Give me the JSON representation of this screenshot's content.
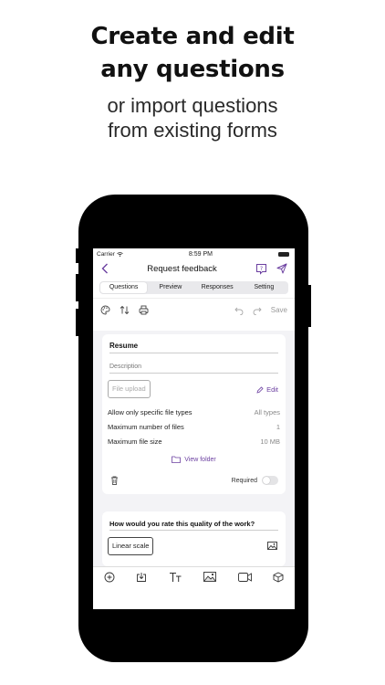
{
  "marketing": {
    "headline_line1": "Create and edit",
    "headline_line2": "any questions",
    "sub_line1": "or import questions",
    "sub_line2": "from existing forms"
  },
  "status_bar": {
    "carrier": "Carrier",
    "time": "8:59 PM"
  },
  "nav": {
    "title": "Request feedback",
    "back_icon": "chevron-left-icon",
    "help_icon": "help-icon",
    "send_icon": "send-icon"
  },
  "tabs": [
    {
      "label": "Questions",
      "active": true
    },
    {
      "label": "Preview",
      "active": false
    },
    {
      "label": "Responses",
      "active": false
    },
    {
      "label": "Setting",
      "active": false
    }
  ],
  "toolbar": {
    "save_label": "Save"
  },
  "card1": {
    "title": "Resume",
    "description_placeholder": "Description",
    "type_chip": "File upload",
    "edit_label": "Edit",
    "rows": [
      {
        "label": "Allow only specific file types",
        "value": "All types"
      },
      {
        "label": "Maximum number of files",
        "value": "1"
      },
      {
        "label": "Maximum file size",
        "value": "10 MB"
      }
    ],
    "view_folder": "View folder",
    "required_label": "Required",
    "required": false
  },
  "card2": {
    "title": "How would you rate this quality of the work?",
    "type_chip": "Linear scale"
  },
  "colors": {
    "accent": "#6b3fa0",
    "phone": "#000000",
    "tabs_bg": "#e9e9ec",
    "content_bg": "#f3f3f6"
  }
}
